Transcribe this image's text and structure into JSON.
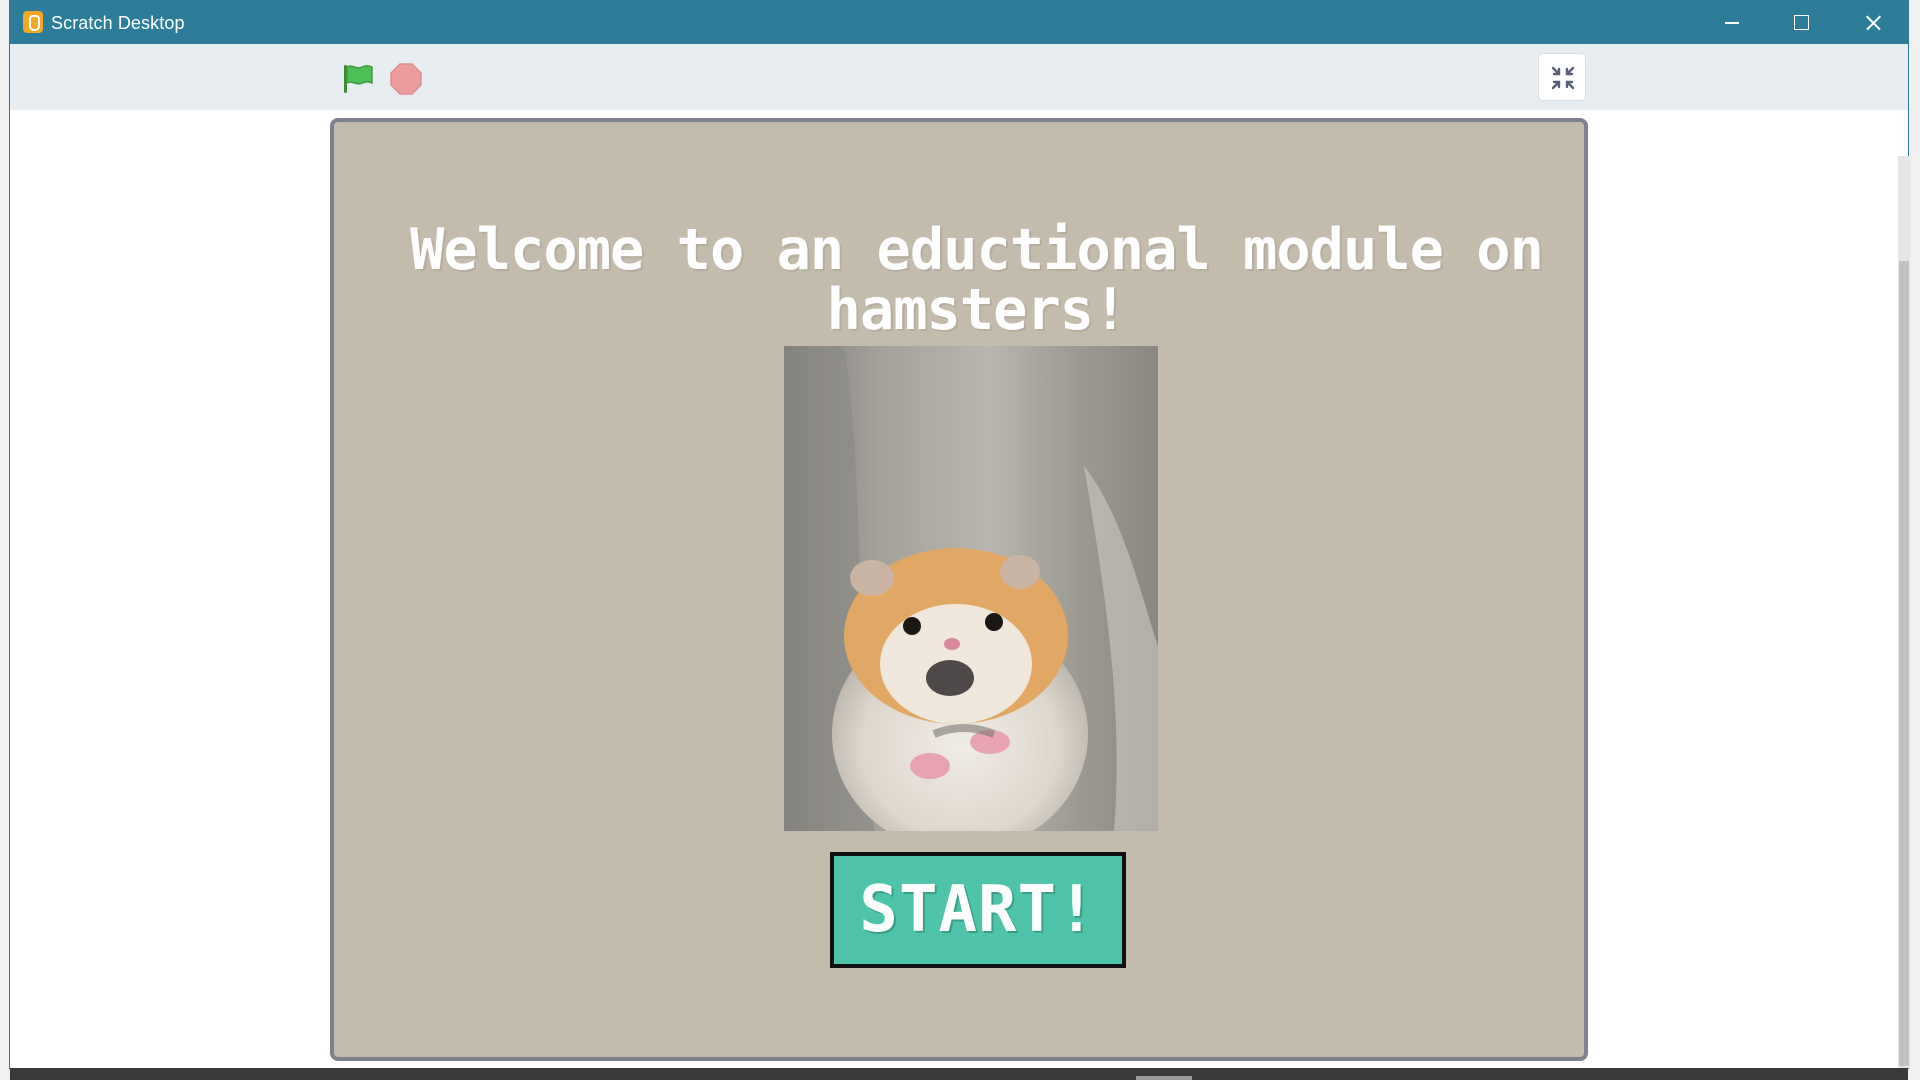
{
  "window": {
    "title": "Scratch Desktop",
    "app_icon": "scratch-cat-icon",
    "controls": {
      "minimize": "minimize-icon",
      "maximize": "maximize-icon",
      "close": "close-icon"
    },
    "titlebar_color": "#2d7d9a"
  },
  "toolbar": {
    "green_flag": "green-flag-icon",
    "stop": "stop-icon",
    "exit_fullscreen": "exit-fullscreen-icon"
  },
  "stage": {
    "background_color": "#c3bbab",
    "title_line1": "Welcome to an eductional module on",
    "title_line2": "hamsters!",
    "image": "scared-hamster-photo",
    "start_button_label": "START!",
    "start_button_color": "#4dc4aa"
  }
}
